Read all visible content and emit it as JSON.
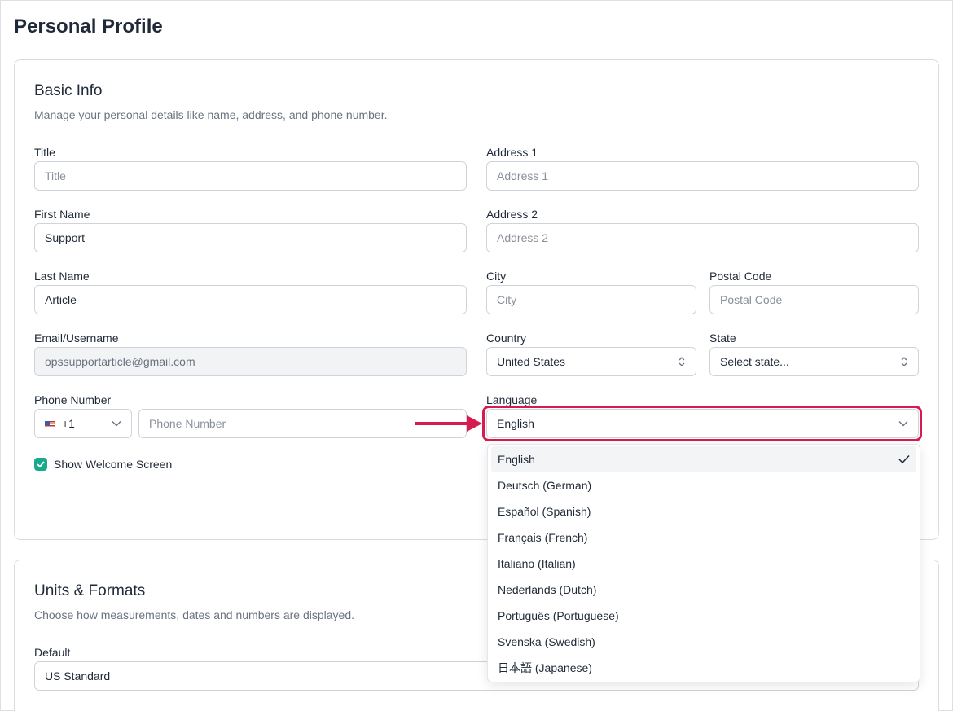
{
  "page": {
    "title": "Personal Profile"
  },
  "basic_info": {
    "title": "Basic Info",
    "description": "Manage your personal details like name, address, and phone number.",
    "title_field": {
      "label": "Title",
      "value": "",
      "placeholder": "Title"
    },
    "first_name": {
      "label": "First Name",
      "value": "Support"
    },
    "last_name": {
      "label": "Last Name",
      "value": "Article"
    },
    "email": {
      "label": "Email/Username",
      "value": "opssupportarticle@gmail.com"
    },
    "phone": {
      "label": "Phone Number",
      "country_code": "+1",
      "placeholder": "Phone Number"
    },
    "address1": {
      "label": "Address 1",
      "placeholder": "Address 1"
    },
    "address2": {
      "label": "Address 2",
      "placeholder": "Address 2"
    },
    "city": {
      "label": "City",
      "placeholder": "City"
    },
    "postal": {
      "label": "Postal Code",
      "placeholder": "Postal Code"
    },
    "country": {
      "label": "Country",
      "value": "United States"
    },
    "state": {
      "label": "State",
      "value": "Select state..."
    },
    "language": {
      "label": "Language",
      "value": "English",
      "options": [
        "English",
        "Deutsch (German)",
        "Español (Spanish)",
        "Français (French)",
        "Italiano (Italian)",
        "Nederlands (Dutch)",
        "Português (Portuguese)",
        "Svenska (Swedish)",
        "日本語 (Japanese)"
      ],
      "selected_index": 0
    },
    "welcome_checkbox": {
      "label": "Show Welcome Screen",
      "checked": true
    }
  },
  "units": {
    "title": "Units & Formats",
    "description": "Choose how measurements, dates and numbers are displayed.",
    "default": {
      "label": "Default",
      "value": "US Standard"
    }
  },
  "colors": {
    "highlight": "#d81b4f",
    "checkbox": "#19a98b"
  }
}
